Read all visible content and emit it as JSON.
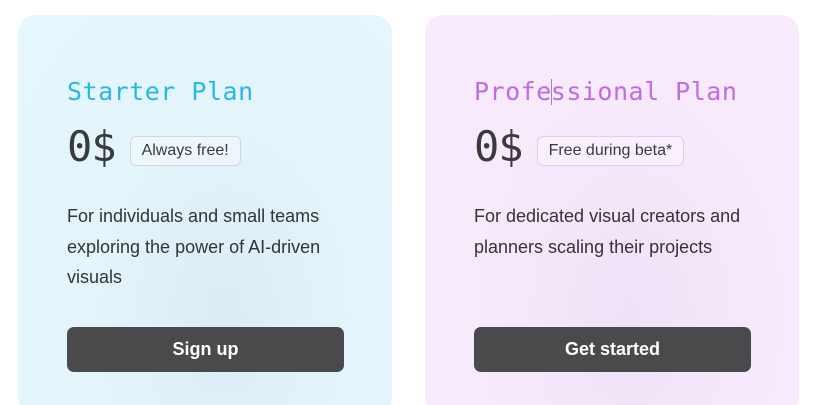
{
  "colors": {
    "starter_title": "#27b8ea",
    "pro_title": "#c06ae6",
    "button_bg": "#4a4a4c"
  },
  "plans": [
    {
      "title": "Starter Plan",
      "price": "0$",
      "badge": "Always free!",
      "description": "For individuals and small teams exploring the power of AI-driven visuals",
      "button": "Sign up"
    },
    {
      "title_part1": "Profe",
      "title_part2": "ssional Plan",
      "price": "0$",
      "badge": "Free during beta*",
      "description": "For dedicated visual creators and planners scaling their projects",
      "button": "Get started"
    }
  ]
}
